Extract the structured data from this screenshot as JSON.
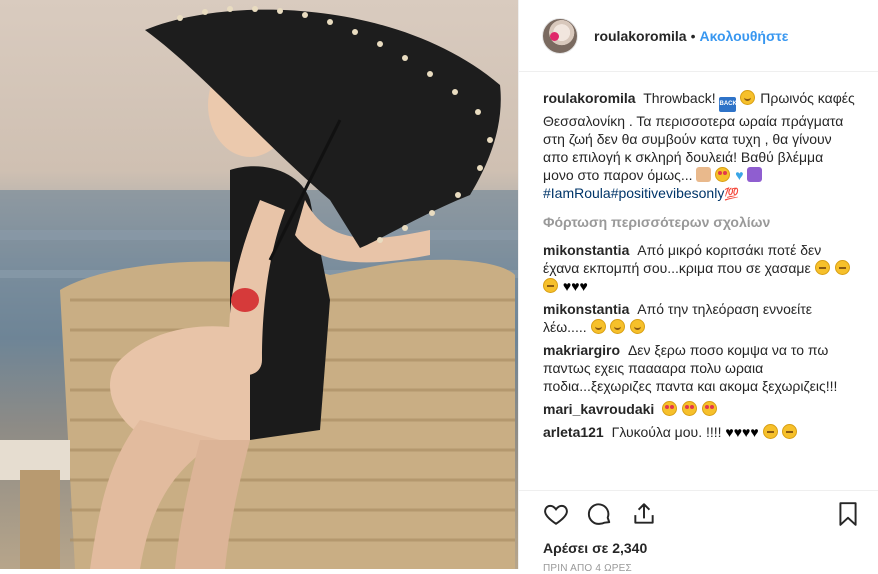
{
  "post": {
    "username": "roulakoromila",
    "separator": "•",
    "follow_label": "Ακολουθήστε",
    "caption": {
      "username": "roulakoromila",
      "text_1": "Throwback!",
      "text_2": "Πρωινός καφές Θεσσαλονίκη . Τα περισσοτερα ωραία πράγματα στη ζωή δεν θα συμβούν κατα τυχη , θα γίνουν απο επιλογή κ σκληρή δουλειά! Βαθύ βλέμμα μονο στο παρον όμως...",
      "hashtags": "#IamRoula#positivevibesonly",
      "hundred": "💯"
    },
    "load_more": "Φόρτωση περισσότερων σχολίων",
    "comments": [
      {
        "username": "mikonstantia",
        "text": "Από μικρό κοριτσάκι ποτέ δεν έχανα εκπομπή σου...κριμα που σε χασαμε"
      },
      {
        "username": "mikonstantia",
        "text": "Από την τηλεόραση εννοείτε λέω....."
      },
      {
        "username": "makriargiro",
        "text": "Δεν ξερω ποσο κομψα να το πω παντως εχεις πααααρα πολυ ωραια ποδια...ξεχωριζες παντα και ακομα ξεχωριζεις!!!"
      },
      {
        "username": "mari_kavroudaki",
        "text": ""
      },
      {
        "username": "arleta121",
        "text": "Γλυκούλα μου. !!!!"
      }
    ],
    "hearts": "♥",
    "likes_text": "Αρέσει σε 2,340",
    "time_text": "ΠΡΙΝ ΑΠΟ 4 ΩΡΕΣ",
    "icons": [
      "heart-outline-icon",
      "comment-bubble-icon",
      "share-upload-icon",
      "bookmark-icon"
    ],
    "colors": {
      "link": "#3897f0",
      "hashtag": "#003569",
      "muted": "#999999",
      "text": "#262626"
    }
  }
}
